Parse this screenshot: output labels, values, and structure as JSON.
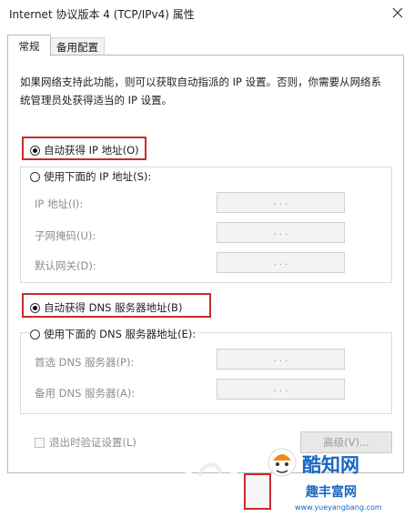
{
  "window": {
    "title": "Internet 协议版本 4 (TCP/IPv4) 属性"
  },
  "tabs": [
    {
      "label": "常规",
      "active": true
    },
    {
      "label": "备用配置",
      "active": false
    }
  ],
  "description": "如果网络支持此功能，则可以获取自动指派的 IP 设置。否则，你需要从网络系统管理员处获得适当的 IP 设置。",
  "ip": {
    "auto_label": "自动获得 IP 地址(O)",
    "auto_selected": true,
    "manual_label": "使用下面的 IP 地址(S):",
    "fields": [
      {
        "label": "IP 地址(I):",
        "value": ".   .   ."
      },
      {
        "label": "子网掩码(U):",
        "value": ".   .   ."
      },
      {
        "label": "默认网关(D):",
        "value": ".   .   ."
      }
    ]
  },
  "dns": {
    "auto_label": "自动获得 DNS 服务器地址(B)",
    "auto_selected": true,
    "manual_label": "使用下面的 DNS 服务器地址(E):",
    "fields": [
      {
        "label": "首选 DNS 服务器(P):",
        "value": ".   .   ."
      },
      {
        "label": "备用 DNS 服务器(A):",
        "value": ".   .   ."
      }
    ]
  },
  "validate_on_exit_label": "退出时验证设置(L)",
  "validate_on_exit_checked": false,
  "advanced_button_label": "高级(V)...",
  "watermark": {
    "brand": "酷知网",
    "site_line": "趣丰富网",
    "url": "www.yueyangbang.com"
  },
  "colors": {
    "highlight": "#cc2a2a",
    "watermark_blue": "#1a66c2"
  }
}
